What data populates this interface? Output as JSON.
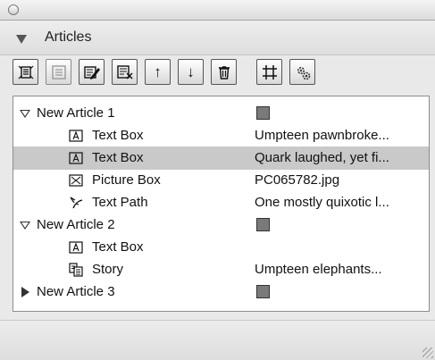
{
  "palette": {
    "header_title": "Articles"
  },
  "toolbar": {
    "buttons": [
      {
        "name": "new-article-button",
        "icon": "new-article-icon"
      },
      {
        "name": "add-to-article-button",
        "icon": "add-to-article-icon"
      },
      {
        "name": "edit-article-button",
        "icon": "edit-article-icon"
      },
      {
        "name": "show-info-button",
        "icon": "info-icon"
      },
      {
        "name": "move-up-button",
        "icon": "up-arrow-icon",
        "glyph": "↑"
      },
      {
        "name": "move-down-button",
        "icon": "down-arrow-icon",
        "glyph": "↓"
      },
      {
        "name": "delete-button",
        "icon": "trash-icon"
      },
      {
        "name": "select-box-button",
        "icon": "crop-icon"
      },
      {
        "name": "settings-button",
        "icon": "gear-icon"
      }
    ]
  },
  "articles": {
    "rows": [
      {
        "label": "New Article 1",
        "type": "article",
        "expanded": true
      },
      {
        "label": "Text Box",
        "type": "text-box",
        "content": "Umpteen pawnbroke..."
      },
      {
        "label": "Text Box",
        "type": "text-box",
        "content": "Quark laughed, yet fi...",
        "selected": true
      },
      {
        "label": "Picture Box",
        "type": "picture-box",
        "content": "PC065782.jpg"
      },
      {
        "label": "Text Path",
        "type": "text-path",
        "content": "One mostly quixotic l..."
      },
      {
        "label": "New Article 2",
        "type": "article",
        "expanded": true
      },
      {
        "label": "Text Box",
        "type": "text-box",
        "content": ""
      },
      {
        "label": "Story",
        "type": "story",
        "content": "Umpteen elephants..."
      },
      {
        "label": "New Article 3",
        "type": "article",
        "expanded": false
      }
    ]
  },
  "colors": {
    "selection": "#c9c9c9",
    "swatch": "#7a7a7a"
  }
}
